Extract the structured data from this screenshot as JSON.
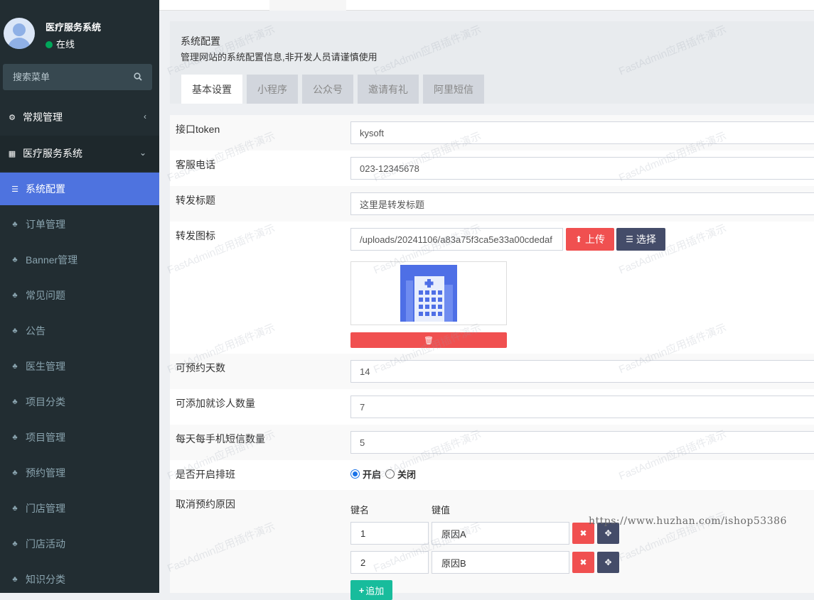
{
  "sidebar": {
    "app_name": "医疗服务系统",
    "status": "在线",
    "search_placeholder": "搜索菜单",
    "items": [
      {
        "label": "常规管理",
        "icon": "cogs-icon"
      },
      {
        "label": "医疗服务系统",
        "icon": "table-icon"
      },
      {
        "label": "系统配置",
        "icon": "sliders-icon"
      },
      {
        "label": "订单管理",
        "icon": "sitemap-icon"
      },
      {
        "label": "Banner管理",
        "icon": "sitemap-icon"
      },
      {
        "label": "常见问题",
        "icon": "sitemap-icon"
      },
      {
        "label": "公告",
        "icon": "sitemap-icon"
      },
      {
        "label": "医生管理",
        "icon": "sitemap-icon"
      },
      {
        "label": "项目分类",
        "icon": "sitemap-icon"
      },
      {
        "label": "项目管理",
        "icon": "sitemap-icon"
      },
      {
        "label": "预约管理",
        "icon": "sitemap-icon"
      },
      {
        "label": "门店管理",
        "icon": "sitemap-icon"
      },
      {
        "label": "门店活动",
        "icon": "sitemap-icon"
      },
      {
        "label": "知识分类",
        "icon": "sitemap-icon"
      }
    ]
  },
  "header": {
    "title": "系统配置",
    "description": "管理网站的系统配置信息,非开发人员请谨慎使用",
    "tabs": [
      "基本设置",
      "小程序",
      "公众号",
      "邀请有礼",
      "阿里短信"
    ]
  },
  "form": {
    "token": {
      "label": "接口token",
      "value": "kysoft"
    },
    "phone": {
      "label": "客服电话",
      "value": "023-12345678"
    },
    "share_title": {
      "label": "转发标题",
      "value": "这里是转发标题"
    },
    "share_icon": {
      "label": "转发图标",
      "value": "/uploads/20241106/a83a75f3ca5e33a00cdedaf",
      "upload_label": "上传",
      "select_label": "选择"
    },
    "days": {
      "label": "可预约天数",
      "value": "14"
    },
    "patients": {
      "label": "可添加就诊人数量",
      "value": "7"
    },
    "sms": {
      "label": "每天每手机短信数量",
      "value": "5"
    },
    "schedule": {
      "label": "是否开启排班",
      "on_label": "开启",
      "off_label": "关闭",
      "selected": "开启"
    },
    "cancel_reasons": {
      "label": "取消预约原因",
      "key_header": "键名",
      "value_header": "键值",
      "rows": [
        {
          "key": "1",
          "value": "原因A"
        },
        {
          "key": "2",
          "value": "原因B"
        }
      ],
      "add_label": "追加"
    }
  },
  "watermark_text": "FastAdmin应用插件演示",
  "url_watermark": "https://www.huzhan.com/ishop53386",
  "colors": {
    "sidebar": "#222d32",
    "active": "#4e73df",
    "danger": "#f05050",
    "dark": "#444c69",
    "success": "#18bc9c"
  }
}
